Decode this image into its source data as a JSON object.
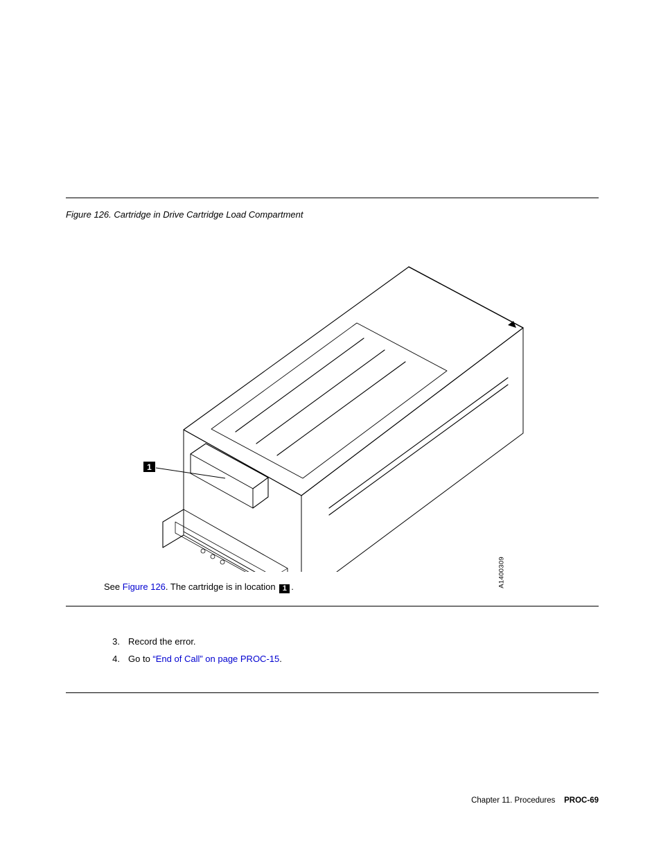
{
  "figure": {
    "label": "Figure 126.",
    "title": "Cartridge in Drive Cartridge Load Compartment",
    "callout_num": "1",
    "image_code": "A1400309"
  },
  "caption": {
    "prefix_before_link": "See ",
    "link_text": "Figure 126",
    "after_link": ". The cartridge is in location ",
    "callout": "1",
    "period": "."
  },
  "steps": [
    {
      "n": "3.",
      "text": "Record the error."
    },
    {
      "n": "4.",
      "text_before": "Go to ",
      "link": "“End of Call” on page PROC-15",
      "text_after": "."
    }
  ],
  "footer": {
    "chapter": "Chapter 11. Procedures",
    "page": "PROC-69"
  }
}
